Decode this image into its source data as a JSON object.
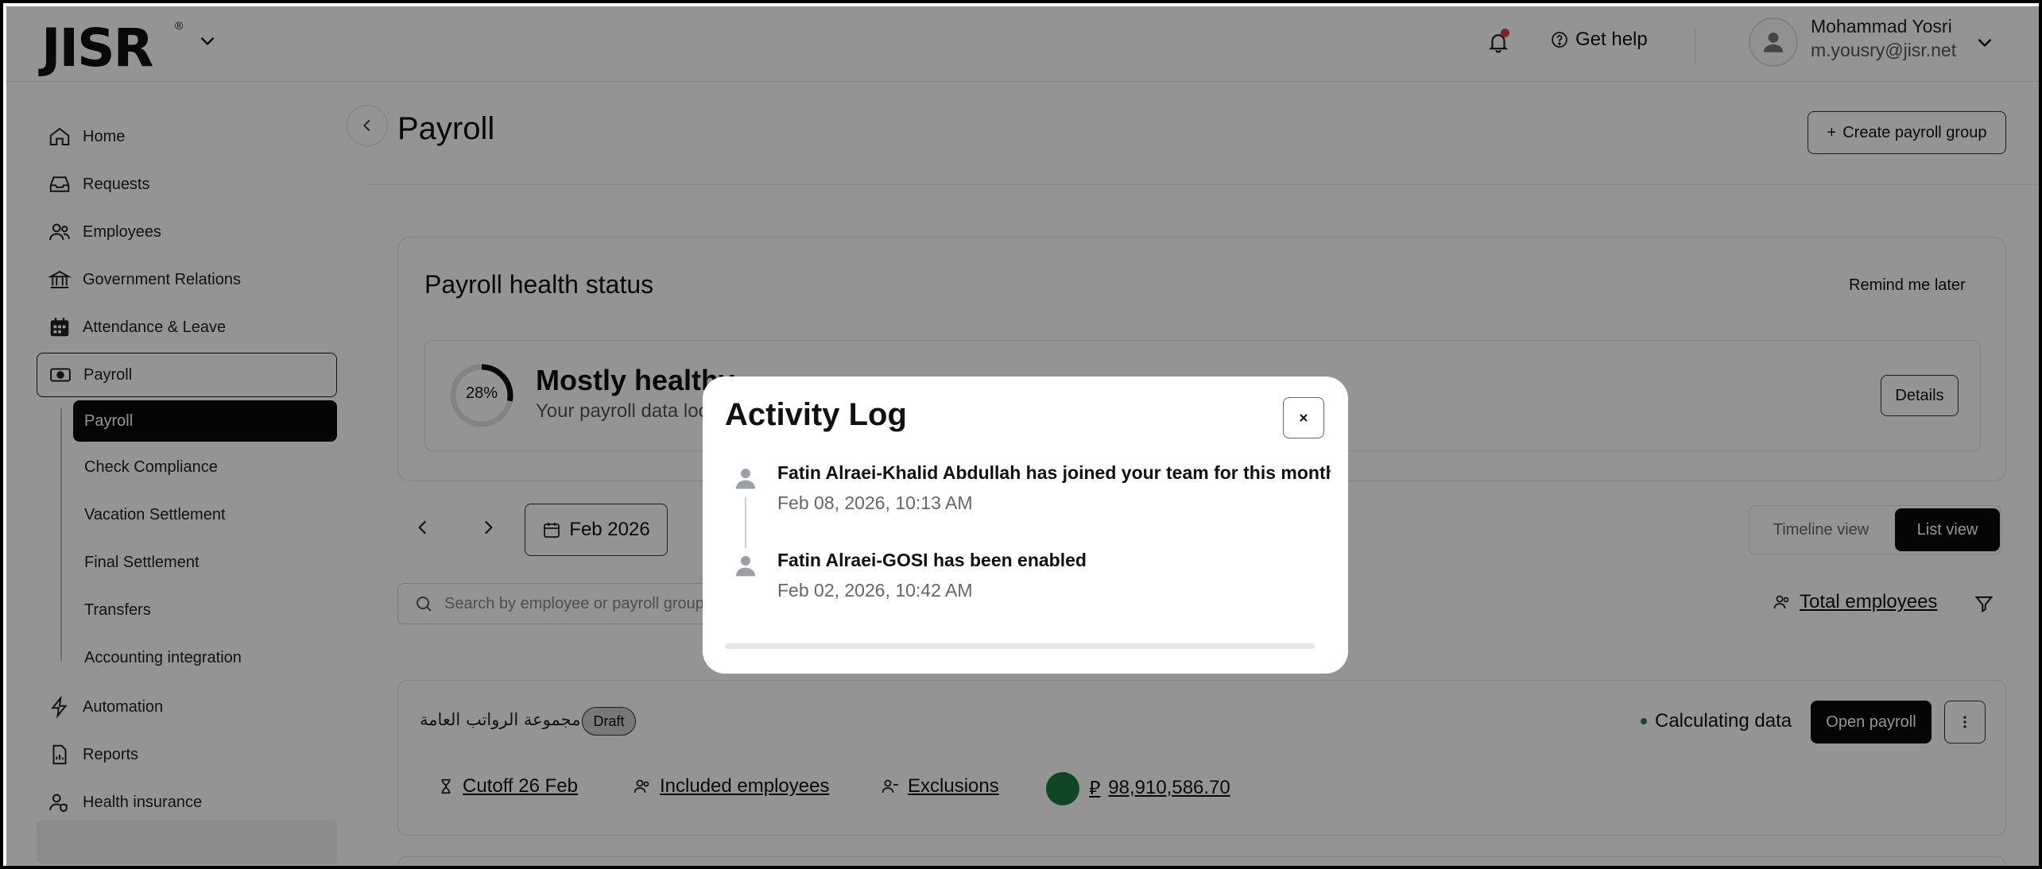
{
  "app": {
    "logo": "JISR"
  },
  "header": {
    "help_label": "Get help",
    "user_name": "Mohammad Yosri",
    "user_email": "m.yousry@jisr.net"
  },
  "sidebar": {
    "items": [
      {
        "label": "Home",
        "icon": "home-icon"
      },
      {
        "label": "Requests",
        "icon": "inbox-icon"
      },
      {
        "label": "Employees",
        "icon": "users-icon"
      },
      {
        "label": "Government Relations",
        "icon": "bank-icon"
      },
      {
        "label": "Attendance & Leave",
        "icon": "calendar-icon"
      },
      {
        "label": "Payroll",
        "icon": "money-icon"
      },
      {
        "label": "Automation",
        "icon": "bolt-icon"
      },
      {
        "label": "Reports",
        "icon": "report-icon"
      },
      {
        "label": "Health insurance",
        "icon": "health-icon"
      }
    ],
    "payroll_sub": [
      "Payroll",
      "Check Compliance",
      "Vacation Settlement",
      "Final Settlement",
      "Transfers",
      "Accounting integration"
    ]
  },
  "main": {
    "title": "Payroll",
    "create_button": "Create payroll group",
    "health": {
      "title": "Payroll health status",
      "remind": "Remind me later",
      "percent_label": "28%",
      "percent_value": 28,
      "status": "Mostly healthy",
      "description": "Your payroll data looks",
      "details_button": "Details"
    },
    "period": "Feb 2026",
    "views": {
      "timeline": "Timeline view",
      "list": "List view"
    },
    "search_placeholder": "Search by employee or payroll group",
    "total_employees": "Total employees",
    "group": {
      "name": "مجموعة الرواتب العامة",
      "badge": "Draft",
      "status": "Calculating data",
      "open_button": "Open payroll",
      "cutoff": "Cutoff 26 Feb",
      "included": "Included employees",
      "exclusions": "Exclusions",
      "amount": "98,910,586.70"
    }
  },
  "modal": {
    "title": "Activity Log",
    "entries": [
      {
        "text": "Fatin Alraei-Khalid Abdullah has joined your team for this month",
        "time": "Feb 08, 2026, 10:13 AM"
      },
      {
        "text": "Fatin Alraei-GOSI has been enabled",
        "time": "Feb 02, 2026, 10:42 AM"
      }
    ]
  },
  "colors": {
    "accent": "#0a0a0a",
    "alert": "#e53935",
    "success": "#2e7d32"
  }
}
